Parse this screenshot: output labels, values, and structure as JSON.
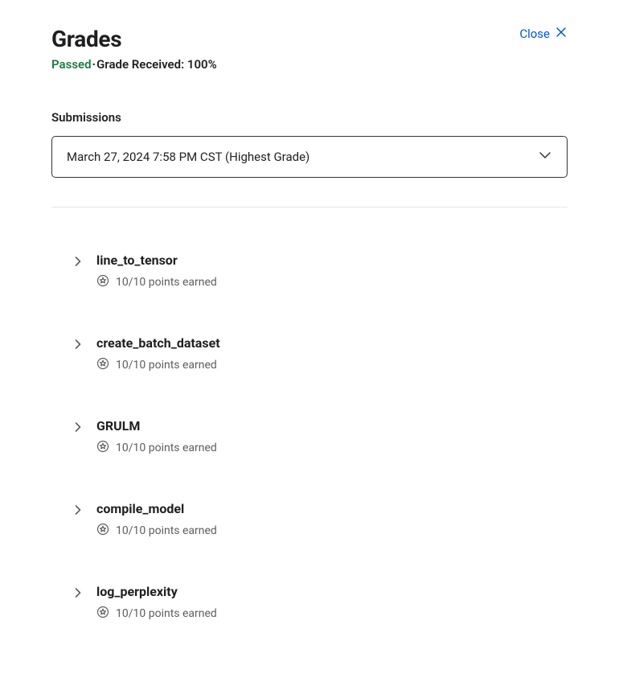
{
  "header": {
    "title": "Grades",
    "close_label": "Close"
  },
  "status": {
    "passed_label": "Passed",
    "separator": "·",
    "grade_text": "Grade Received: 100%"
  },
  "submissions": {
    "label": "Submissions",
    "selected": "March 27, 2024 7:58 PM CST (Highest Grade)"
  },
  "items": [
    {
      "title": "line_to_tensor",
      "points": "10/10 points earned"
    },
    {
      "title": "create_batch_dataset",
      "points": "10/10 points earned"
    },
    {
      "title": "GRULM",
      "points": "10/10 points earned"
    },
    {
      "title": "compile_model",
      "points": "10/10 points earned"
    },
    {
      "title": "log_perplexity",
      "points": "10/10 points earned"
    }
  ]
}
